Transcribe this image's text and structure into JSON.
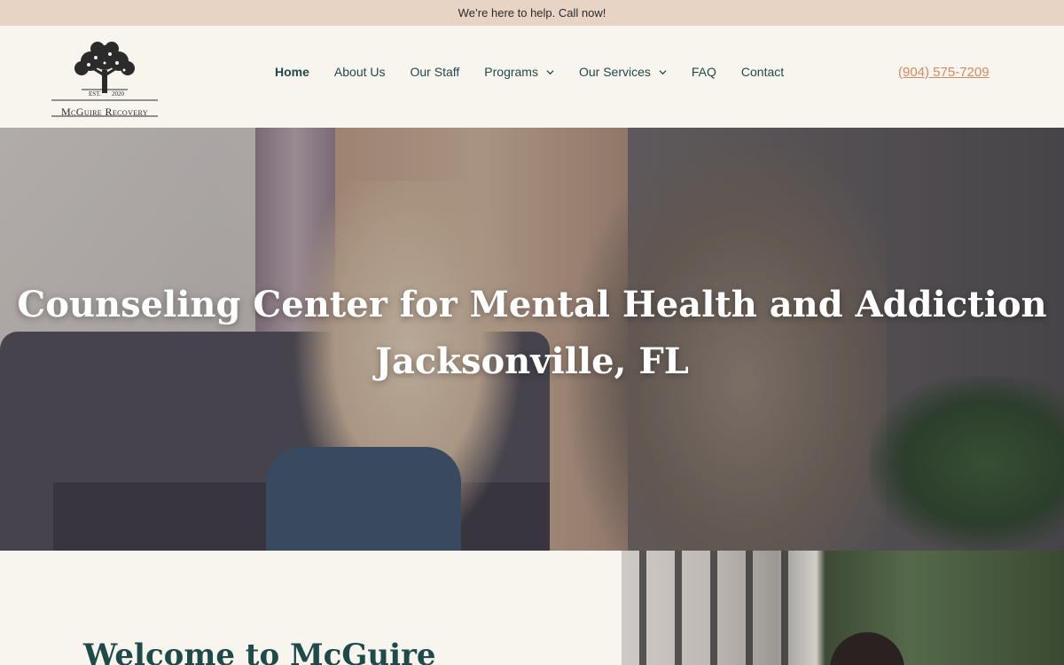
{
  "topbar": {
    "text": "We’re here to help. Call now!"
  },
  "logo": {
    "est": "EST.",
    "year": "2020",
    "name": "McGuire Recovery"
  },
  "nav": {
    "items": [
      {
        "label": "Home"
      },
      {
        "label": "About Us"
      },
      {
        "label": "Our Staff"
      },
      {
        "label": "Programs"
      },
      {
        "label": "Our Services"
      },
      {
        "label": "FAQ"
      },
      {
        "label": "Contact"
      }
    ],
    "phone": "(904) 575-7209"
  },
  "hero": {
    "title_line1": "Counseling Center for Mental Health and Addiction",
    "title_line2": "Jacksonville, FL"
  },
  "welcome": {
    "heading": "Welcome to McGuire"
  },
  "colors": {
    "accent": "#1f4a4a",
    "phone": "#d08a63",
    "topbar": "#e8d4c4",
    "background": "#f8f5ef"
  }
}
